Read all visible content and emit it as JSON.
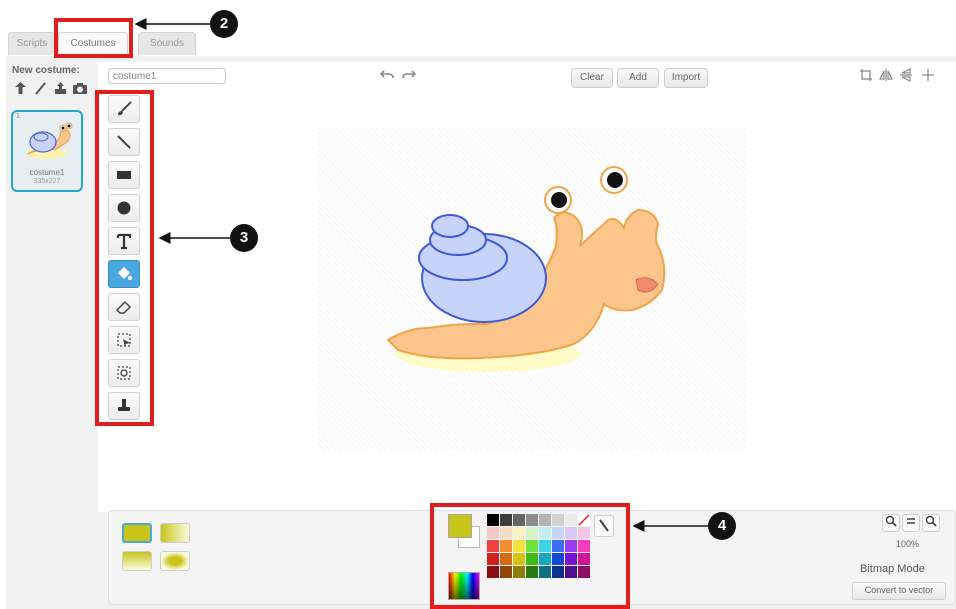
{
  "tabs": [
    {
      "label": "Scripts"
    },
    {
      "label": "Costumes",
      "active": true
    },
    {
      "label": "Sounds"
    }
  ],
  "left_pane": {
    "new_costume_label": "New costume:",
    "new_costume_icons": [
      "sprite-library-icon",
      "paint-brush-icon",
      "upload-icon",
      "camera-icon"
    ],
    "costume": {
      "number": "1",
      "name": "costume1",
      "size": "335x227"
    }
  },
  "editor": {
    "costume_name_value": "costume1",
    "undo_icon": "undo-icon",
    "redo_icon": "redo-icon",
    "clear_label": "Clear",
    "add_label": "Add",
    "import_label": "Import",
    "right_icons": [
      "crop-icon",
      "flip-horizontal-icon",
      "flip-vertical-icon",
      "set-center-icon"
    ],
    "tools": [
      {
        "name": "brush-tool",
        "icon": "paintbrush"
      },
      {
        "name": "line-tool",
        "icon": "line"
      },
      {
        "name": "rectangle-tool",
        "icon": "rectangle"
      },
      {
        "name": "ellipse-tool",
        "icon": "ellipse"
      },
      {
        "name": "text-tool",
        "icon": "T"
      },
      {
        "name": "fill-tool",
        "icon": "bucket",
        "selected": true
      },
      {
        "name": "eraser-tool",
        "icon": "eraser"
      },
      {
        "name": "select-tool",
        "icon": "select"
      },
      {
        "name": "select-remove-background-tool",
        "icon": "magic-select"
      },
      {
        "name": "stamp-tool",
        "icon": "stamp"
      }
    ]
  },
  "bottom": {
    "primary_color": "#c8c41a",
    "secondary_color": "#ffffff",
    "zoom_level": "100%",
    "mode_label": "Bitmap Mode",
    "convert_label": "Convert to vector"
  },
  "palette": [
    "#000000",
    "#3c3c3c",
    "#646464",
    "#8c8c8c",
    "#b4b4b4",
    "#d2d2d2",
    "#ebebeb",
    "#ffffff",
    "#f7c6c6",
    "#f8dcc4",
    "#fbf3c1",
    "#d6f5c6",
    "#c7eef5",
    "#c6d4f7",
    "#dcc6f7",
    "#f7c6e7",
    "#f24040",
    "#f48c30",
    "#f3e23b",
    "#6fe03c",
    "#38d5e8",
    "#3b6ff2",
    "#9b3bf2",
    "#f23bbd",
    "#d21f1f",
    "#d46b14",
    "#d6c20f",
    "#3dbb16",
    "#14a9c0",
    "#1448d4",
    "#7514d4",
    "#d4149a",
    "#8c1010",
    "#8c460a",
    "#8c800a",
    "#2a7a0f",
    "#0f707f",
    "#0f2f8c",
    "#4e0f8c",
    "#8c0f66"
  ],
  "callouts": [
    "2",
    "3",
    "4"
  ]
}
